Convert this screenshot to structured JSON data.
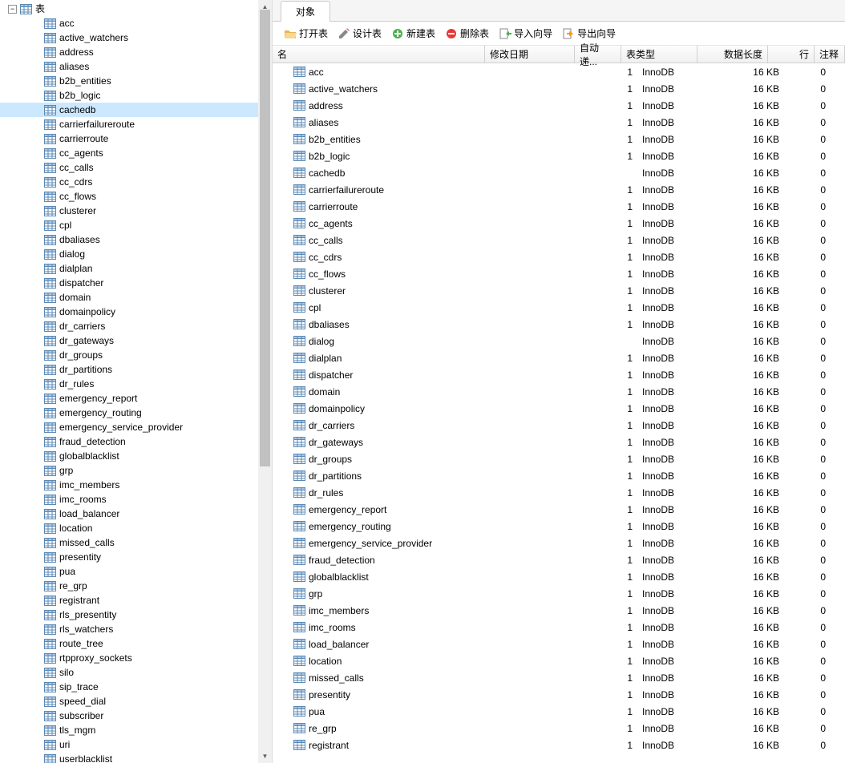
{
  "sidebar": {
    "root": {
      "label": "表",
      "expanded": true
    },
    "selected_index": 7,
    "items": [
      "acc",
      "active_watchers",
      "address",
      "aliases",
      "b2b_entities",
      "b2b_logic",
      "cachedb",
      "carrierfailureroute",
      "carrierroute",
      "cc_agents",
      "cc_calls",
      "cc_cdrs",
      "cc_flows",
      "clusterer",
      "cpl",
      "dbaliases",
      "dialog",
      "dialplan",
      "dispatcher",
      "domain",
      "domainpolicy",
      "dr_carriers",
      "dr_gateways",
      "dr_groups",
      "dr_partitions",
      "dr_rules",
      "emergency_report",
      "emergency_routing",
      "emergency_service_provider",
      "fraud_detection",
      "globalblacklist",
      "grp",
      "imc_members",
      "imc_rooms",
      "load_balancer",
      "location",
      "missed_calls",
      "presentity",
      "pua",
      "re_grp",
      "registrant",
      "rls_presentity",
      "rls_watchers",
      "route_tree",
      "rtpproxy_sockets",
      "silo",
      "sip_trace",
      "speed_dial",
      "subscriber",
      "tls_mgm",
      "uri",
      "userblacklist"
    ]
  },
  "tabs": {
    "active": "对象"
  },
  "toolbar": {
    "open": "打开表",
    "design": "设计表",
    "new": "新建表",
    "delete": "删除表",
    "import": "导入向导",
    "export": "导出向导"
  },
  "grid": {
    "headers": {
      "name": "名",
      "modified": "修改日期",
      "auto": "自动递...",
      "type": "表类型",
      "length": "数据长度",
      "rows": "行",
      "comment": "注释"
    },
    "rows": [
      {
        "name": "acc",
        "auto": "1",
        "type": "InnoDB",
        "length": "16 KB",
        "rows": "0"
      },
      {
        "name": "active_watchers",
        "auto": "1",
        "type": "InnoDB",
        "length": "16 KB",
        "rows": "0"
      },
      {
        "name": "address",
        "auto": "1",
        "type": "InnoDB",
        "length": "16 KB",
        "rows": "0"
      },
      {
        "name": "aliases",
        "auto": "1",
        "type": "InnoDB",
        "length": "16 KB",
        "rows": "0"
      },
      {
        "name": "b2b_entities",
        "auto": "1",
        "type": "InnoDB",
        "length": "16 KB",
        "rows": "0"
      },
      {
        "name": "b2b_logic",
        "auto": "1",
        "type": "InnoDB",
        "length": "16 KB",
        "rows": "0"
      },
      {
        "name": "cachedb",
        "auto": "",
        "type": "InnoDB",
        "length": "16 KB",
        "rows": "0"
      },
      {
        "name": "carrierfailureroute",
        "auto": "1",
        "type": "InnoDB",
        "length": "16 KB",
        "rows": "0"
      },
      {
        "name": "carrierroute",
        "auto": "1",
        "type": "InnoDB",
        "length": "16 KB",
        "rows": "0"
      },
      {
        "name": "cc_agents",
        "auto": "1",
        "type": "InnoDB",
        "length": "16 KB",
        "rows": "0"
      },
      {
        "name": "cc_calls",
        "auto": "1",
        "type": "InnoDB",
        "length": "16 KB",
        "rows": "0"
      },
      {
        "name": "cc_cdrs",
        "auto": "1",
        "type": "InnoDB",
        "length": "16 KB",
        "rows": "0"
      },
      {
        "name": "cc_flows",
        "auto": "1",
        "type": "InnoDB",
        "length": "16 KB",
        "rows": "0"
      },
      {
        "name": "clusterer",
        "auto": "1",
        "type": "InnoDB",
        "length": "16 KB",
        "rows": "0"
      },
      {
        "name": "cpl",
        "auto": "1",
        "type": "InnoDB",
        "length": "16 KB",
        "rows": "0"
      },
      {
        "name": "dbaliases",
        "auto": "1",
        "type": "InnoDB",
        "length": "16 KB",
        "rows": "0"
      },
      {
        "name": "dialog",
        "auto": "",
        "type": "InnoDB",
        "length": "16 KB",
        "rows": "0"
      },
      {
        "name": "dialplan",
        "auto": "1",
        "type": "InnoDB",
        "length": "16 KB",
        "rows": "0"
      },
      {
        "name": "dispatcher",
        "auto": "1",
        "type": "InnoDB",
        "length": "16 KB",
        "rows": "0"
      },
      {
        "name": "domain",
        "auto": "1",
        "type": "InnoDB",
        "length": "16 KB",
        "rows": "0"
      },
      {
        "name": "domainpolicy",
        "auto": "1",
        "type": "InnoDB",
        "length": "16 KB",
        "rows": "0"
      },
      {
        "name": "dr_carriers",
        "auto": "1",
        "type": "InnoDB",
        "length": "16 KB",
        "rows": "0"
      },
      {
        "name": "dr_gateways",
        "auto": "1",
        "type": "InnoDB",
        "length": "16 KB",
        "rows": "0"
      },
      {
        "name": "dr_groups",
        "auto": "1",
        "type": "InnoDB",
        "length": "16 KB",
        "rows": "0"
      },
      {
        "name": "dr_partitions",
        "auto": "1",
        "type": "InnoDB",
        "length": "16 KB",
        "rows": "0"
      },
      {
        "name": "dr_rules",
        "auto": "1",
        "type": "InnoDB",
        "length": "16 KB",
        "rows": "0"
      },
      {
        "name": "emergency_report",
        "auto": "1",
        "type": "InnoDB",
        "length": "16 KB",
        "rows": "0"
      },
      {
        "name": "emergency_routing",
        "auto": "1",
        "type": "InnoDB",
        "length": "16 KB",
        "rows": "0"
      },
      {
        "name": "emergency_service_provider",
        "auto": "1",
        "type": "InnoDB",
        "length": "16 KB",
        "rows": "0"
      },
      {
        "name": "fraud_detection",
        "auto": "1",
        "type": "InnoDB",
        "length": "16 KB",
        "rows": "0"
      },
      {
        "name": "globalblacklist",
        "auto": "1",
        "type": "InnoDB",
        "length": "16 KB",
        "rows": "0"
      },
      {
        "name": "grp",
        "auto": "1",
        "type": "InnoDB",
        "length": "16 KB",
        "rows": "0"
      },
      {
        "name": "imc_members",
        "auto": "1",
        "type": "InnoDB",
        "length": "16 KB",
        "rows": "0"
      },
      {
        "name": "imc_rooms",
        "auto": "1",
        "type": "InnoDB",
        "length": "16 KB",
        "rows": "0"
      },
      {
        "name": "load_balancer",
        "auto": "1",
        "type": "InnoDB",
        "length": "16 KB",
        "rows": "0"
      },
      {
        "name": "location",
        "auto": "1",
        "type": "InnoDB",
        "length": "16 KB",
        "rows": "0"
      },
      {
        "name": "missed_calls",
        "auto": "1",
        "type": "InnoDB",
        "length": "16 KB",
        "rows": "0"
      },
      {
        "name": "presentity",
        "auto": "1",
        "type": "InnoDB",
        "length": "16 KB",
        "rows": "0"
      },
      {
        "name": "pua",
        "auto": "1",
        "type": "InnoDB",
        "length": "16 KB",
        "rows": "0"
      },
      {
        "name": "re_grp",
        "auto": "1",
        "type": "InnoDB",
        "length": "16 KB",
        "rows": "0"
      },
      {
        "name": "registrant",
        "auto": "1",
        "type": "InnoDB",
        "length": "16 KB",
        "rows": "0"
      }
    ]
  }
}
